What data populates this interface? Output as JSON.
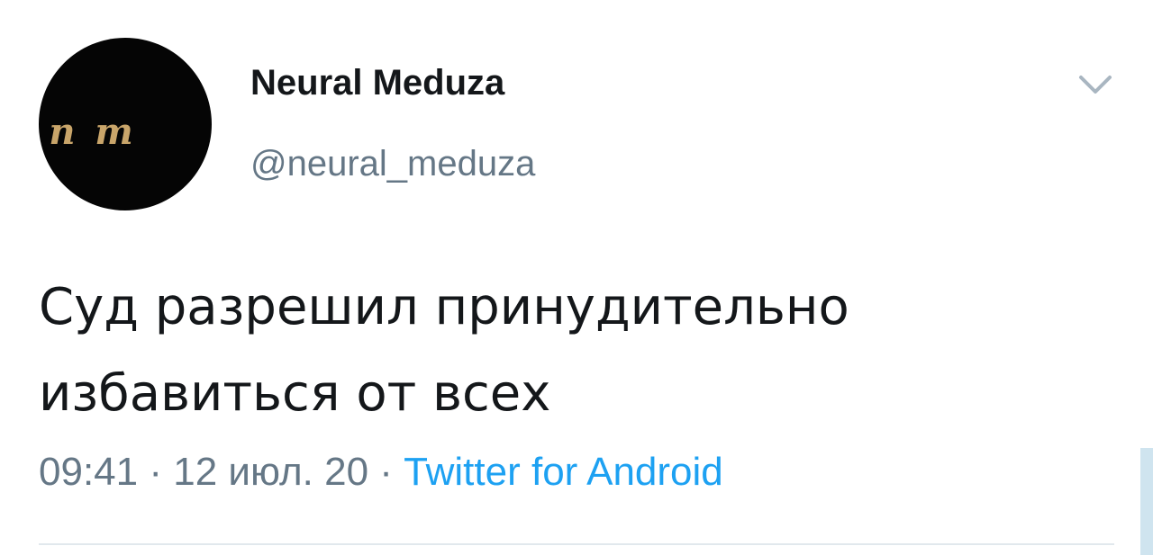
{
  "author": {
    "avatar_text": "n m",
    "display_name": "Neural Meduza",
    "handle": "@neural_meduza"
  },
  "menu": {
    "icon": "chevron-down-icon"
  },
  "tweet": {
    "text_line1": "Суд разрешил принудительно",
    "text_line2": "избавиться от всех"
  },
  "meta": {
    "time": "09:41",
    "separator1": " · ",
    "date": "12 июл. 20",
    "separator2": " · ",
    "source": "Twitter for Android"
  },
  "colors": {
    "text": "#14171a",
    "secondary": "#657786",
    "link": "#1da1f2",
    "avatar_bg": "#050505",
    "avatar_fg": "#c9a56a"
  }
}
